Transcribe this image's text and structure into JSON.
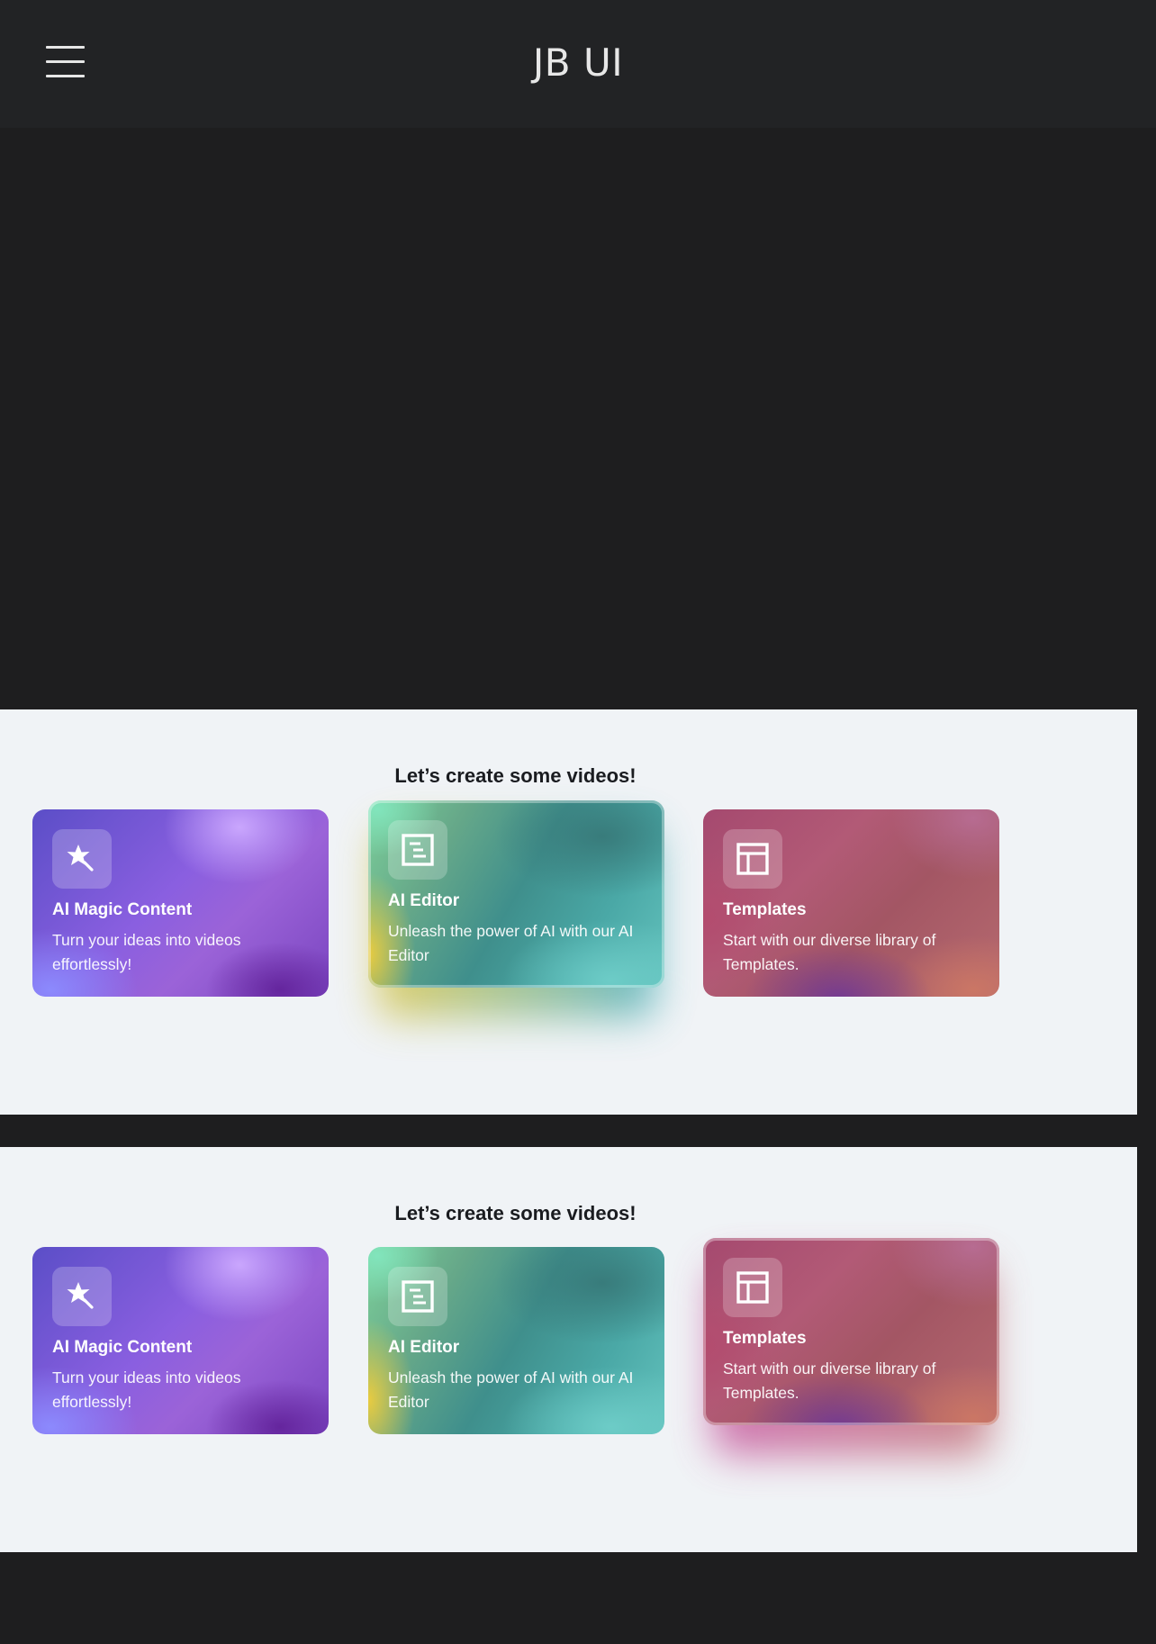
{
  "header": {
    "title": "JB UI"
  },
  "sections": [
    {
      "heading": "Let’s create some videos!",
      "cards": [
        {
          "icon": "magic-wand-icon",
          "title": "AI Magic Content",
          "description": "Turn your ideas into videos effortlessly!"
        },
        {
          "icon": "editor-document-icon",
          "title": "AI Editor",
          "description": "Unleash the power of AI with our AI Editor"
        },
        {
          "icon": "layout-template-icon",
          "title": "Templates",
          "description": "Start with our diverse library of Templates."
        }
      ]
    },
    {
      "heading": "Let’s create some videos!",
      "cards": [
        {
          "icon": "magic-wand-icon",
          "title": "AI Magic Content",
          "description": "Turn your ideas into videos effortlessly!"
        },
        {
          "icon": "editor-document-icon",
          "title": "AI Editor",
          "description": "Unleash the power of AI with our AI Editor"
        },
        {
          "icon": "layout-template-icon",
          "title": "Templates",
          "description": "Start with our diverse library of Templates."
        }
      ]
    }
  ],
  "colors": {
    "page_background": "#1e1e1f",
    "header_background": "#222325",
    "panel_background": "#f0f3f6",
    "heading_text": "#1a1c20",
    "card_text": "#ffffff"
  }
}
